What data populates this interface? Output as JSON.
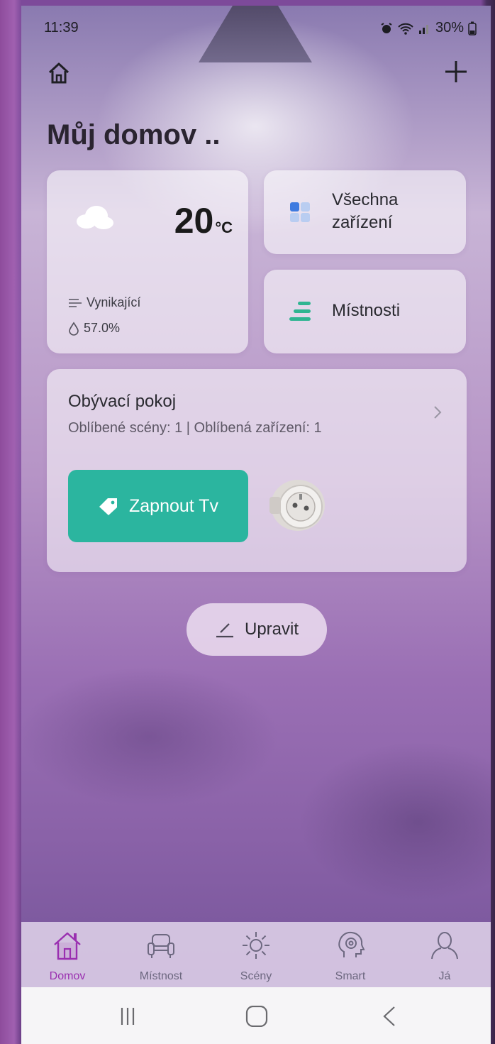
{
  "status_bar": {
    "time": "11:39",
    "battery": "30%"
  },
  "header": {
    "title": "Můj domov .."
  },
  "weather": {
    "temperature": "20",
    "unit": "°C",
    "air_quality": "Vynikající",
    "humidity": "57.0%"
  },
  "quick_actions": {
    "all_devices": [
      "Všechna",
      "zařízení"
    ],
    "rooms": "Místnosti"
  },
  "room_card": {
    "name": "Obývací pokoj",
    "favorites": "Oblíbené scény: 1  |  Oblíbená zařízení: 1",
    "scene": "Zapnout Tv"
  },
  "edit_button": "Upravit",
  "tabs": [
    {
      "label": "Domov",
      "icon": "home-icon",
      "active": true
    },
    {
      "label": "Místnost",
      "icon": "armchair-icon",
      "active": false
    },
    {
      "label": "Scény",
      "icon": "sun-icon",
      "active": false
    },
    {
      "label": "Smart",
      "icon": "brain-icon",
      "active": false
    },
    {
      "label": "Já",
      "icon": "user-icon",
      "active": false
    }
  ],
  "colors": {
    "accent": "#2bb59f",
    "active_tab": "#9a2fb0",
    "device_blue": "#3f7be0"
  }
}
